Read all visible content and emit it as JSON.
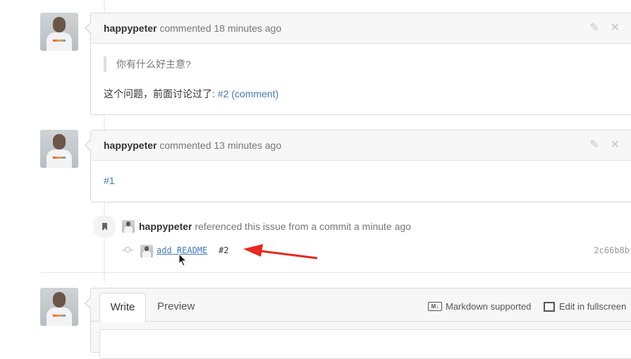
{
  "comments": [
    {
      "author": "happypeter",
      "meta": "commented 18 minutes ago",
      "quote": "你有什么好主意?",
      "text": "这个问题，前面讨论过了: ",
      "link_text": "#2 (comment)"
    },
    {
      "author": "happypeter",
      "meta": "commented 13 minutes ago",
      "link_text": "#1"
    }
  ],
  "reference_event": {
    "author": "happypeter",
    "text": "referenced this issue from a commit a minute ago",
    "commit_message": "add README",
    "commit_issue": "#2",
    "commit_sha": "2c66b8b"
  },
  "editor": {
    "tabs": [
      "Write",
      "Preview"
    ],
    "markdown_label": "Markdown supported",
    "fullscreen_label": "Edit in fullscreen"
  },
  "annotation_color": "#e8271e"
}
